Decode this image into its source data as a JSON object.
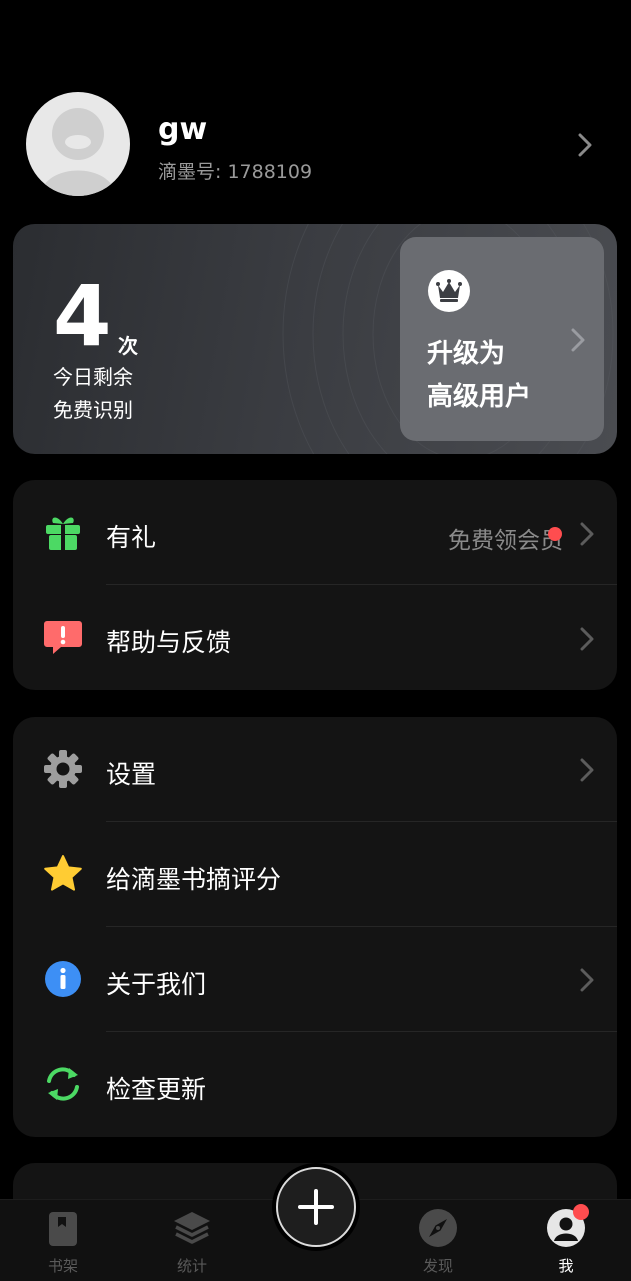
{
  "profile": {
    "username": "gw",
    "id_label": "滴墨号: 1788109"
  },
  "quota": {
    "count": "4",
    "unit": "次",
    "line1": "今日剩余",
    "line2": "免费识别",
    "upgrade_line1": "升级为",
    "upgrade_line2": "高级用户"
  },
  "group1": {
    "items": [
      {
        "label": "有礼",
        "trailing": "免费领会员",
        "icon": "gift-icon",
        "icon_color": "#4cd964"
      },
      {
        "label": "帮助与反馈",
        "icon": "feedback-icon",
        "icon_color": "#ff6b6b"
      }
    ]
  },
  "group2": {
    "items": [
      {
        "label": "设置",
        "icon": "gear-icon",
        "icon_color": "#9e9e9e"
      },
      {
        "label": "给滴墨书摘评分",
        "icon": "star-icon",
        "icon_color": "#ffcc33"
      },
      {
        "label": "关于我们",
        "icon": "info-icon",
        "icon_color": "#3d8ff5"
      },
      {
        "label": "检查更新",
        "icon": "refresh-icon",
        "icon_color": "#4cd964"
      }
    ]
  },
  "tabbar": {
    "tabs": [
      {
        "label": "书架",
        "icon": "bookshelf-icon",
        "active": false
      },
      {
        "label": "统计",
        "icon": "stats-layers-icon",
        "active": false
      },
      {
        "label": "",
        "icon": "plus-icon",
        "active": false
      },
      {
        "label": "发现",
        "icon": "compass-icon",
        "active": false
      },
      {
        "label": "我",
        "icon": "user-icon",
        "active": true
      }
    ]
  },
  "colors": {
    "background": "#000000",
    "card": "#141414",
    "badge_red": "#ff4d4f"
  }
}
